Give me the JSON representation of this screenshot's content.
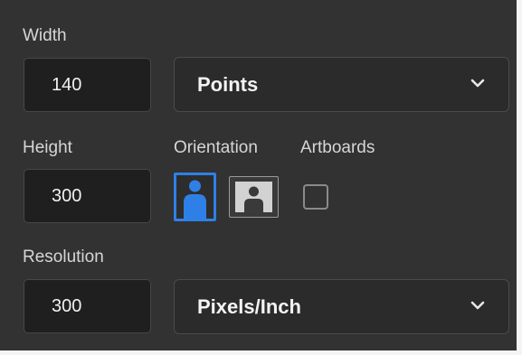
{
  "width": {
    "label": "Width",
    "value": "140",
    "unit": "Points"
  },
  "height": {
    "label": "Height",
    "value": "300"
  },
  "orientation": {
    "label": "Orientation",
    "selected": "portrait",
    "portrait_icon": "portrait-person-icon",
    "landscape_icon": "landscape-person-icon"
  },
  "artboards": {
    "label": "Artboards",
    "checked": false
  },
  "resolution": {
    "label": "Resolution",
    "value": "300",
    "unit": "Pixels/Inch"
  },
  "colors": {
    "panel_bg": "#323232",
    "field_bg": "#1f1f1f",
    "accent": "#2f80e6",
    "text": "#f1f1f1",
    "label": "#d6d6d6"
  }
}
